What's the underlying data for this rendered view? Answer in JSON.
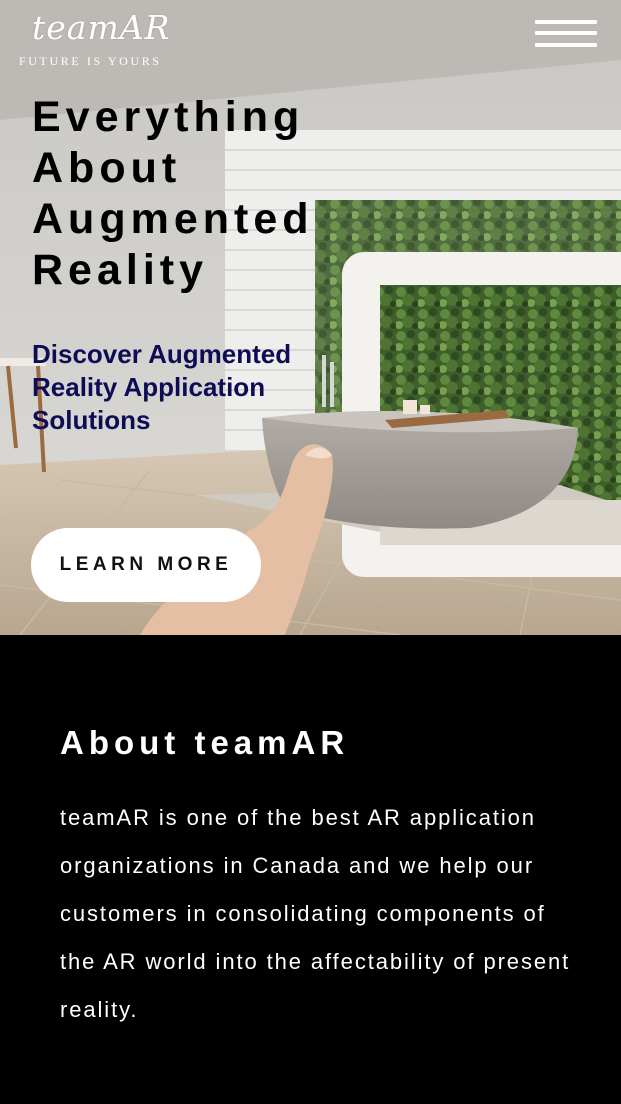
{
  "header": {
    "logo_text": "teamAR",
    "tagline": "FUTURE IS YOURS",
    "menu_icon": "hamburger-menu-icon"
  },
  "hero": {
    "title": "Everything About Augmented Reality",
    "subtitle": "Discover Augmented Reality Application Solutions",
    "cta_label": "LEARN MORE",
    "background_image": "bathroom-with-ar-tablet-photo"
  },
  "about": {
    "title": "About teamAR",
    "body": "teamAR is one of the best AR application organizations in Canada and we help our customers in consolidating components of the AR world into the affectability of present reality."
  },
  "colors": {
    "subtitle": "#0e0c55",
    "about_bg": "#000000",
    "button_bg": "#ffffff"
  }
}
